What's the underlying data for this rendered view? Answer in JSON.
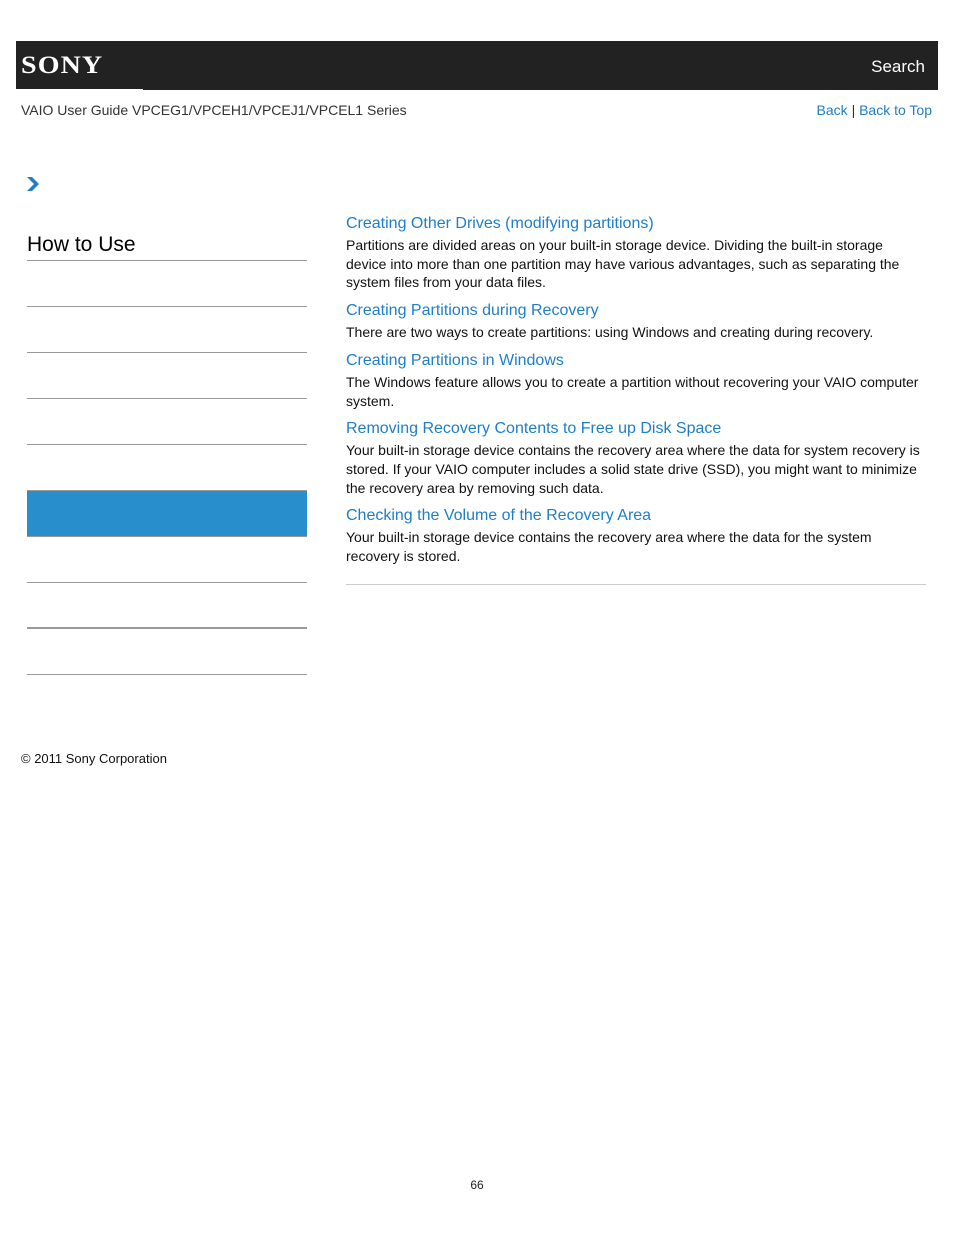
{
  "header": {
    "brand": "SONY",
    "search_label": "Search"
  },
  "subheader": {
    "guide_title": "VAIO User Guide VPCEG1/VPCEH1/VPCEJ1/VPCEL1 Series",
    "back_label": "Back",
    "separator": "|",
    "back_to_top_label": "Back to Top"
  },
  "sidebar": {
    "title": "How to Use",
    "items": [
      {
        "label": "",
        "active": false
      },
      {
        "label": "",
        "active": false
      },
      {
        "label": "",
        "active": false
      },
      {
        "label": "",
        "active": false
      },
      {
        "label": "",
        "active": false
      },
      {
        "label": "",
        "active": true
      },
      {
        "label": "",
        "active": false
      },
      {
        "label": "",
        "active": false
      },
      {
        "label": "",
        "active": false
      }
    ]
  },
  "content": {
    "entries": [
      {
        "title": "Creating Other Drives (modifying partitions)",
        "description": "Partitions are divided areas on your built-in storage device. Dividing the built-in storage device into more than one partition may have various advantages, such as separating the system files from your data files."
      },
      {
        "title": "Creating Partitions during Recovery",
        "description": "There are two ways to create partitions: using Windows and creating during recovery."
      },
      {
        "title": "Creating Partitions in Windows",
        "description": "The Windows feature allows you to create a partition without recovering your VAIO computer system."
      },
      {
        "title": "Removing Recovery Contents to Free up Disk Space",
        "description": "Your built-in storage device contains the recovery area where the data for system recovery is stored. If your VAIO computer includes a solid state drive (SSD), you might want to minimize the recovery area by removing such data."
      },
      {
        "title": "Checking the Volume of the Recovery Area",
        "description": "Your built-in storage device contains the recovery area where the data for the system recovery is stored."
      }
    ]
  },
  "footer": {
    "copyright": "© 2011 Sony Corporation",
    "page_number": "66"
  },
  "colors": {
    "header_bg": "#222222",
    "link": "#1e7ec8",
    "active_item": "#288ecc"
  }
}
